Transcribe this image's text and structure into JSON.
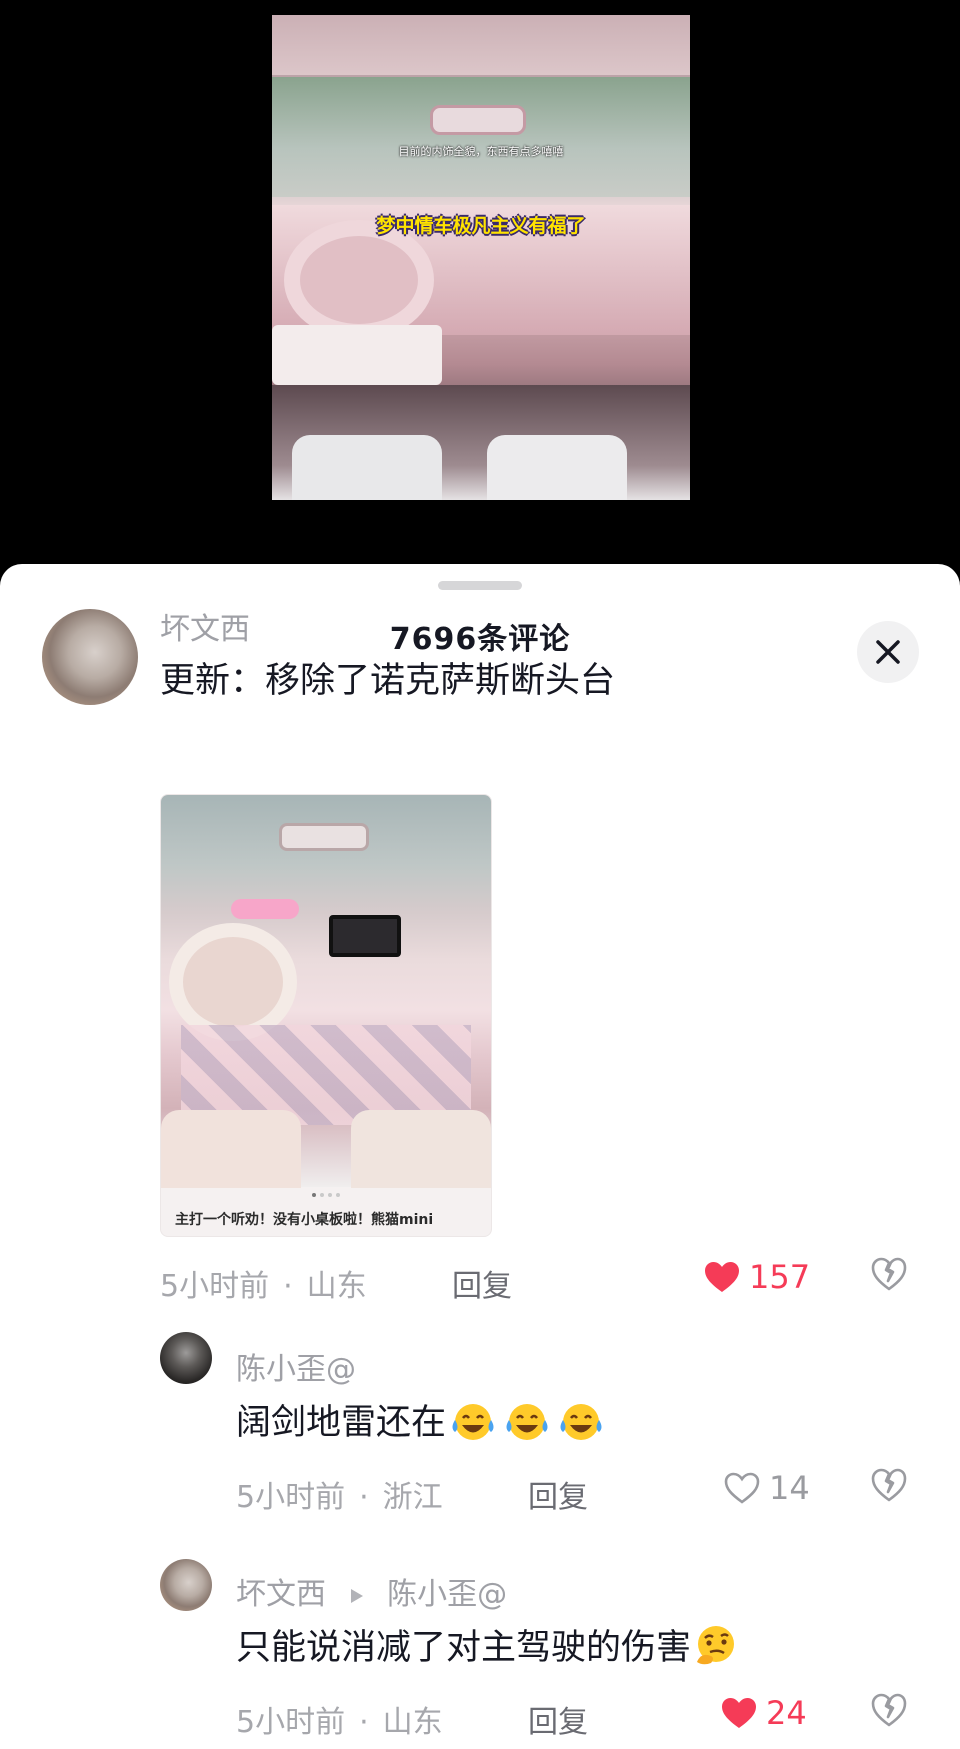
{
  "video": {
    "caption_small": "目前的内饰全貌，东西有点多嘻嘻",
    "caption_big": "梦中情车极凡主义有福了"
  },
  "sheet": {
    "title": "7696条评论"
  },
  "comments": [
    {
      "username": "坏文西",
      "text": "更新：移除了诺克萨斯断头台",
      "image_caption": "主打一个听劝！没有小桌板啦！熊猫mini",
      "time": "5小时前",
      "location": "山东",
      "reply_label": "回复",
      "likes": "157",
      "liked": true
    }
  ],
  "replies": [
    {
      "username": "陈小歪@",
      "text": "阔剑地雷还在",
      "emojis": [
        "laugh-cry-icon",
        "laugh-cry-icon",
        "laugh-cry-icon"
      ],
      "time": "5小时前",
      "location": "浙江",
      "reply_label": "回复",
      "likes": "14",
      "liked": false
    },
    {
      "username": "坏文西",
      "reply_to": "陈小歪@",
      "text": "只能说消减了对主驾驶的伤害",
      "emojis": [
        "thinking-icon"
      ],
      "time": "5小时前",
      "location": "山东",
      "reply_label": "回复",
      "likes": "24",
      "liked": true
    }
  ],
  "colors": {
    "like_red": "#f53b57",
    "text_primary": "#161823",
    "text_secondary": "#a6a7ac"
  }
}
